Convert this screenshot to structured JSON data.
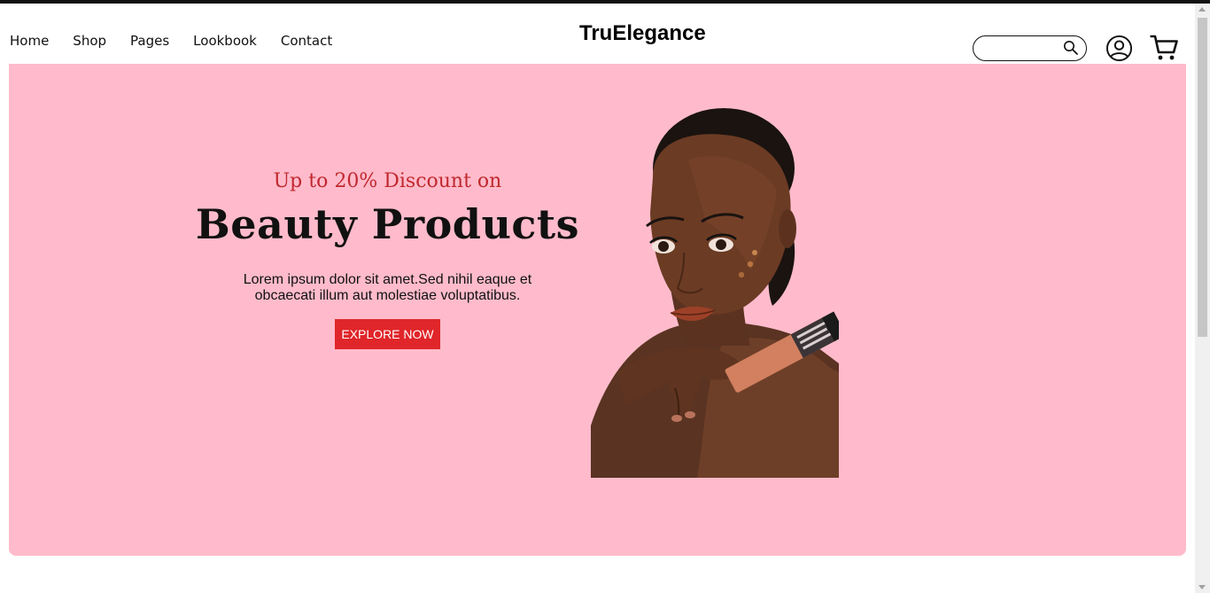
{
  "header": {
    "nav": [
      "Home",
      "Shop",
      "Pages",
      "Lookbook",
      "Contact"
    ],
    "logo": "TruElegance",
    "search_value": "",
    "icons": [
      "search-icon",
      "user-icon",
      "cart-icon"
    ]
  },
  "hero": {
    "subtitle": "Up to 20% Discount on",
    "title": "Beauty Products",
    "description": "Lorem ipsum dolor sit amet.Sed nihil eaque et obcaecati illum aut molestiae voluptatibus.",
    "cta_label": "EXPLORE NOW",
    "colors": {
      "background": "#ffbbcb",
      "accent": "#e0262a",
      "subtitle": "#c0282e"
    }
  }
}
